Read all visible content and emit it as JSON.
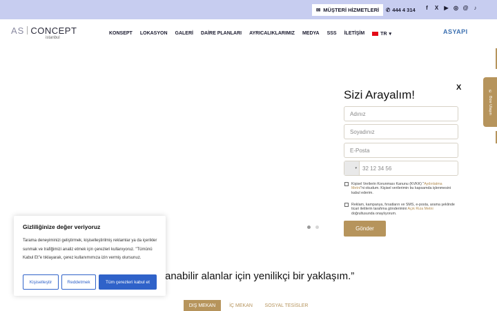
{
  "topbar": {
    "services_label": "MÜŞTERİ HİZMETLERİ",
    "phone": "444 4 314",
    "socials": [
      "facebook-icon",
      "x-icon",
      "youtube-icon",
      "instagram-icon",
      "threads-icon",
      "tiktok-icon"
    ]
  },
  "header": {
    "logo_as": "AS",
    "logo_concept": "CONCEPT",
    "logo_city": "istanbul",
    "nav": [
      "KONSEPT",
      "LOKASYON",
      "GALERİ",
      "DAİRE PLANLARI",
      "AYRICALIKLARIMIZ",
      "MEDYA",
      "SSS",
      "İLETİŞİM"
    ],
    "lang": "TR",
    "partner_logo": "ASYAPI"
  },
  "form": {
    "title": "Sizi Arayalım!",
    "close": "X",
    "name_placeholder": "Adınız",
    "surname_placeholder": "Soyadınız",
    "email_placeholder": "E-Posta",
    "phone_placeholder": "32 12 34 56",
    "kvkk_pre": "Kişisel Verilerin Korunması Kanunu (KVKK) \"",
    "kvkk_link": "Aydınlatma Metni",
    "kvkk_post": "\"ni okudum. Kişisel verilerimin bu kapsamda işlenmesini kabul ederim.",
    "consent_pre": "Reklam, kampanya, fırsatların ve SMS, e-posta, arama şeklinde ticari iletilerin tarafıma gönderimini ",
    "consent_link": "Açık Rıza Metni",
    "consent_post": " doğrultusunda onaylıyorum.",
    "submit": "Gönder"
  },
  "side_tab": "Bize Ulaşın",
  "slider": {
    "active_dot": 1,
    "dot_count": 2
  },
  "quote": "anabilir alanlar için yenilikçi bir yaklaşım.”",
  "tabs": [
    {
      "label": "DIŞ MEKAN",
      "active": true
    },
    {
      "label": "İÇ MEKAN",
      "active": false
    },
    {
      "label": "SOSYAL TESİSLER",
      "active": false
    }
  ],
  "cookie": {
    "title": "Gizliliğinize değer veriyoruz",
    "text": "Tarama deneyiminizi geliştirmek, kişiselleştirilmiş reklamlar ya da içerikler sunmak ve trafiğimizi analiz etmek için çerezleri kullanıyoruz. \"Tümünü Kabul Et\"e tıklayarak, çerez kullanımımıza izin vermiş olursunuz.",
    "customize": "Kişiselleştir",
    "reject": "Reddetmek",
    "accept_all": "Tüm çerezleri kabul et"
  },
  "colors": {
    "gold": "#b6945c",
    "topbar": "#c7cdf0",
    "cookie_blue": "#2f62c9"
  }
}
